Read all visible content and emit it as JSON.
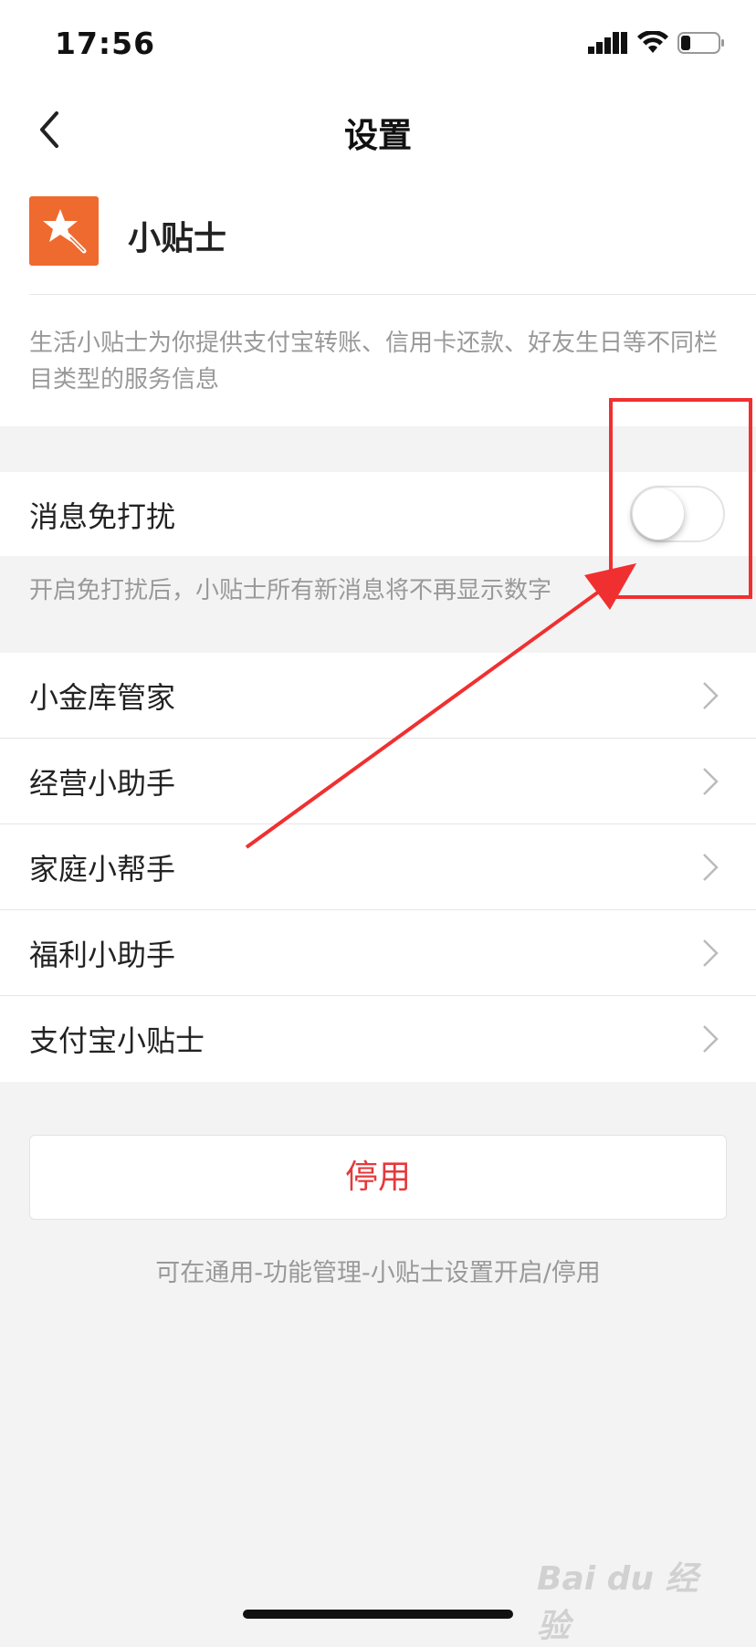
{
  "status_bar": {
    "time": "17:56"
  },
  "nav": {
    "title": "设置"
  },
  "app_info": {
    "name": "小贴士",
    "icon": "magic-wand-icon",
    "icon_color": "#ef6a2f",
    "description": "生活小贴士为你提供支付宝转账、信用卡还款、好友生日等不同栏目类型的服务信息"
  },
  "do_not_disturb": {
    "label": "消息免打扰",
    "enabled": false,
    "hint": "开启免打扰后，小贴士所有新消息将不再显示数字"
  },
  "list_items": [
    {
      "label": "小金库管家"
    },
    {
      "label": "经营小助手"
    },
    {
      "label": "家庭小帮手"
    },
    {
      "label": "福利小助手"
    },
    {
      "label": "支付宝小贴士"
    }
  ],
  "disable_button": {
    "label": "停用",
    "color": "#e4393c"
  },
  "footer_hint": "可在通用-功能管理-小贴士设置开启/停用",
  "annotation_color": "#f03030",
  "watermark": "Bai du 经验"
}
